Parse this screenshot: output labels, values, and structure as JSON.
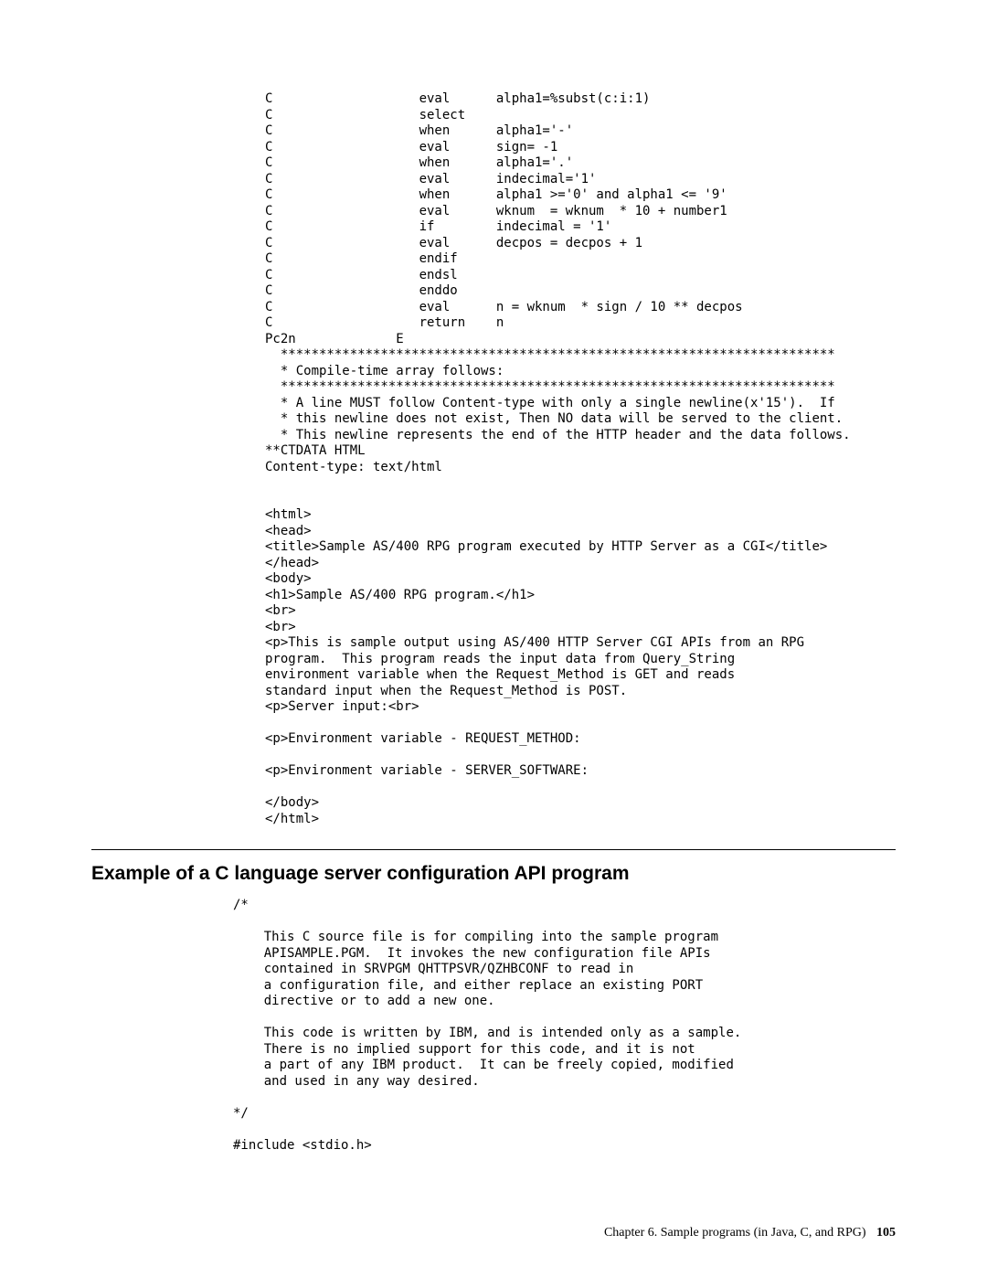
{
  "codeblock1": "C                   eval      alpha1=%subst(c:i:1)\nC                   select\nC                   when      alpha1='-'\nC                   eval      sign= -1\nC                   when      alpha1='.'\nC                   eval      indecimal='1'\nC                   when      alpha1 >='0' and alpha1 <= '9'\nC                   eval      wknum  = wknum  * 10 + number1\nC                   if        indecimal = '1'\nC                   eval      decpos = decpos + 1\nC                   endif\nC                   endsl\nC                   enddo\nC                   eval      n = wknum  * sign / 10 ** decpos\nC                   return    n\nPc2n             E\n  ************************************************************************\n  * Compile-time array follows:\n  ************************************************************************\n  * A line MUST follow Content-type with only a single newline(x'15').  If\n  * this newline does not exist, Then NO data will be served to the client.\n  * This newline represents the end of the HTTP header and the data follows.\n**CTDATA HTML\nContent-type: text/html\n\n\n<html>\n<head>\n<title>Sample AS/400 RPG program executed by HTTP Server as a CGI</title>\n</head>\n<body>\n<h1>Sample AS/400 RPG program.</h1>\n<br>\n<br>\n<p>This is sample output using AS/400 HTTP Server CGI APIs from an RPG\nprogram.  This program reads the input data from Query_String\nenvironment variable when the Request_Method is GET and reads\nstandard input when the Request_Method is POST.\n<p>Server input:<br>\n\n<p>Environment variable - REQUEST_METHOD:\n\n<p>Environment variable - SERVER_SOFTWARE:\n\n</body>\n</html>",
  "section_title": "Example of a C language server configuration API program",
  "codeblock2": "/*\n\n    This C source file is for compiling into the sample program\n    APISAMPLE.PGM.  It invokes the new configuration file APIs\n    contained in SRVPGM QHTTPSVR/QZHBCONF to read in\n    a configuration file, and either replace an existing PORT\n    directive or to add a new one.\n\n    This code is written by IBM, and is intended only as a sample.\n    There is no implied support for this code, and it is not\n    a part of any IBM product.  It can be freely copied, modified\n    and used in any way desired.\n\n*/\n\n#include <stdio.h>",
  "footer": {
    "chapter": "Chapter 6. Sample programs (in Java, C, and RPG)",
    "pagenum": "105"
  }
}
